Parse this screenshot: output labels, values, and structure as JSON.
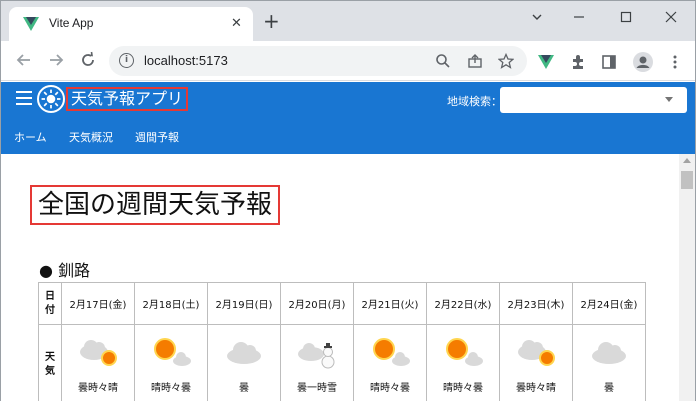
{
  "browser": {
    "tab_title": "Vite App",
    "tab_close": "✕",
    "new_tab": "+",
    "url": "localhost:5173",
    "window_controls": [
      "minimize-icon",
      "maximize-icon",
      "close-icon"
    ]
  },
  "app": {
    "title": "天気予報アプリ",
    "search_label": "地域検索：",
    "search_value": "",
    "colors": {
      "appbar": "#1976d2",
      "highlight": "#e53935"
    }
  },
  "nav": {
    "tabs": [
      "ホーム",
      "天気概況",
      "週間予報"
    ],
    "active": "ホーム"
  },
  "main": {
    "title": "全国の週間天気予報",
    "city": "● 釧路",
    "row_labels": {
      "date": "日付",
      "weather": "天気"
    },
    "days": [
      {
        "date": "2月17日(金)",
        "weather": "曇時々晴",
        "icon": "cloud-sun-icon"
      },
      {
        "date": "2月18日(土)",
        "weather": "晴時々曇",
        "icon": "sun-cloud-icon"
      },
      {
        "date": "2月19日(日)",
        "weather": "曇",
        "icon": "cloud-icon"
      },
      {
        "date": "2月20日(月)",
        "weather": "曇一時雪",
        "icon": "cloud-snow-icon"
      },
      {
        "date": "2月21日(火)",
        "weather": "晴時々曇",
        "icon": "sun-cloud-icon"
      },
      {
        "date": "2月22日(水)",
        "weather": "晴時々曇",
        "icon": "sun-cloud-icon"
      },
      {
        "date": "2月23日(木)",
        "weather": "曇時々晴",
        "icon": "cloud-sun-icon"
      },
      {
        "date": "2月24日(金)",
        "weather": "曇",
        "icon": "cloud-icon"
      }
    ]
  }
}
